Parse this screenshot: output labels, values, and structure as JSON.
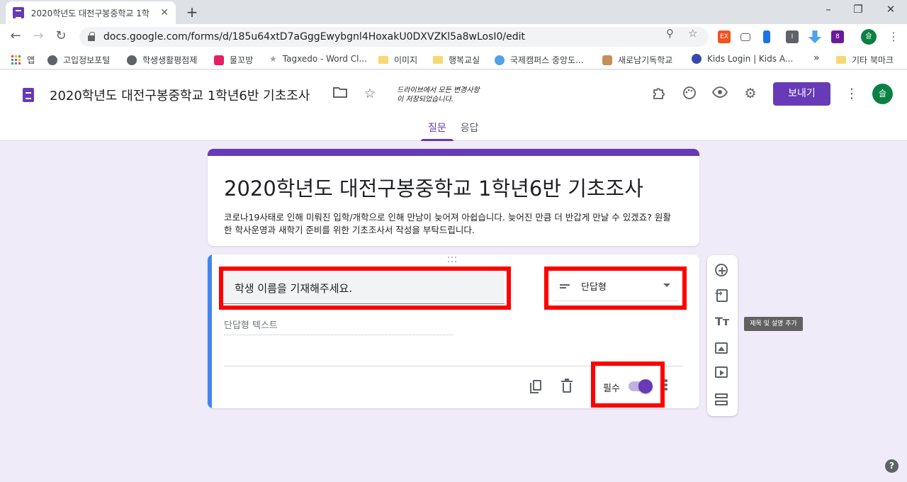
{
  "browser": {
    "tab_title": "2020학년도 대전구봉중학교 1학",
    "new_tab": "+",
    "tab_close": "✕",
    "url": "docs.google.com/forms/d/185u64xtD7aGggEwybgnl4HoxakU0DXVZKl5a8wLosI0/edit",
    "extensions": [
      "EX",
      "I",
      "8"
    ],
    "profile_initial": "슬",
    "window_controls": [
      "–",
      "❐",
      "✕"
    ]
  },
  "bookmarks": {
    "items": [
      {
        "label": "앱",
        "icon": "apps-grid-icon"
      },
      {
        "label": "고입정보포털",
        "icon": "globe-icon"
      },
      {
        "label": "학생생활평점제",
        "icon": "globe-icon"
      },
      {
        "label": "물꼬방",
        "icon": "site-icon"
      },
      {
        "label": "Tagxedo - Word Cl...",
        "icon": "star-icon"
      },
      {
        "label": "이미지",
        "icon": "folder-icon"
      },
      {
        "label": "행복교실",
        "icon": "folder-icon"
      },
      {
        "label": "국제캠퍼스 중앙도...",
        "icon": "cloud-icon"
      },
      {
        "label": "새로남기독학교",
        "icon": "site-icon"
      },
      {
        "label": "Kids Login | Kids A...",
        "icon": "site-icon"
      }
    ],
    "overflow": "»",
    "other": "기타 북마크"
  },
  "forms_header": {
    "title": "2020학년도 대전구봉중학교 1학년6반 기초조사",
    "saved_note": "드라이브에서 모든 변경사항\n이 저장되었습니다.",
    "send_label": "보내기",
    "avatar_initial": "슬",
    "tabs": [
      {
        "label": "질문",
        "active": true
      },
      {
        "label": "응답",
        "active": false
      }
    ]
  },
  "form": {
    "title": "2020학년도 대전구봉중학교 1학년6반 기초조사",
    "description": "코로나19사태로 인해 미뤄진 입학/개학으로 인해 만남이 늦어져 아쉽습니다. 늦어진 만큼 더 반갑게 만날 수 있겠죠? 원활한 학사운영과 새학기 준비를 위한 기초조사서 작성을 부탁드립니다."
  },
  "question": {
    "text": "학생 이름을 기재해주세요.",
    "type": "단답형",
    "answer_placeholder": "단답형 텍스트",
    "required_label": "필수",
    "required": true
  },
  "side_toolbar": {
    "tooltip": "제목 및 설명 추가",
    "text_icon": "Tт"
  },
  "help": "?",
  "colors": {
    "brand": "#673ab7",
    "page_bg": "#f0ebf8",
    "question_accent": "#4285f4",
    "highlight": "#ff0000"
  }
}
